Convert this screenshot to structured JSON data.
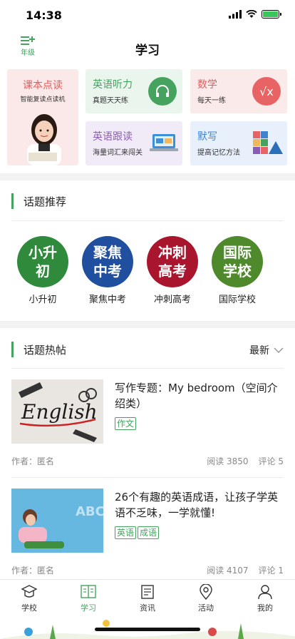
{
  "status_bar": {
    "time": "14:38"
  },
  "nav": {
    "title": "学习",
    "grade_label": "年级"
  },
  "features": {
    "textbook": {
      "title": "课本点读",
      "subtitle": "智能复读点读机"
    },
    "listening": {
      "title": "英语听力",
      "subtitle": "真题天天练"
    },
    "math": {
      "title": "数学",
      "subtitle": "每天一练"
    },
    "follow_read": {
      "title": "英语跟读",
      "subtitle": "海量词汇来闯关"
    },
    "dictation": {
      "title": "默写",
      "subtitle": "提高记忆方法"
    }
  },
  "topics_section": {
    "title": "话题推荐",
    "items": [
      {
        "circle_text": "小升初",
        "label": "小升初",
        "color": "#2f8a3c"
      },
      {
        "circle_text": "聚焦中考",
        "label": "聚焦中考",
        "color": "#1f4f9e"
      },
      {
        "circle_text": "冲刺高考",
        "label": "冲刺高考",
        "color": "#a8152d"
      },
      {
        "circle_text": "国际学校",
        "label": "国际学校",
        "color": "#4e8a2c"
      }
    ]
  },
  "hot_section": {
    "title": "话题热帖",
    "sort_label": "最新"
  },
  "posts": [
    {
      "title": "写作专题：My bedroom（空间介绍类）",
      "thumb_text": "English",
      "tags": [
        "作文"
      ],
      "author": "作者：匿名",
      "reads": "阅读 3850",
      "comments": "评论 5"
    },
    {
      "title": "26个有趣的英语成语，让孩子学英语不乏味，一学就懂!",
      "thumb_text": "ABC",
      "tags": [
        "英语",
        "成语"
      ],
      "author": "作者：匿名",
      "reads": "阅读 4107",
      "comments": "评论 1"
    }
  ],
  "tab_bar": {
    "items": [
      {
        "label": "学校",
        "icon": "mortarboard-icon"
      },
      {
        "label": "学习",
        "icon": "book-icon"
      },
      {
        "label": "资讯",
        "icon": "news-icon"
      },
      {
        "label": "活动",
        "icon": "location-pin-icon"
      },
      {
        "label": "我的",
        "icon": "person-icon"
      }
    ],
    "active_index": 1
  },
  "colors": {
    "accent": "#46a35f",
    "textbook_red": "#e35d5d"
  }
}
